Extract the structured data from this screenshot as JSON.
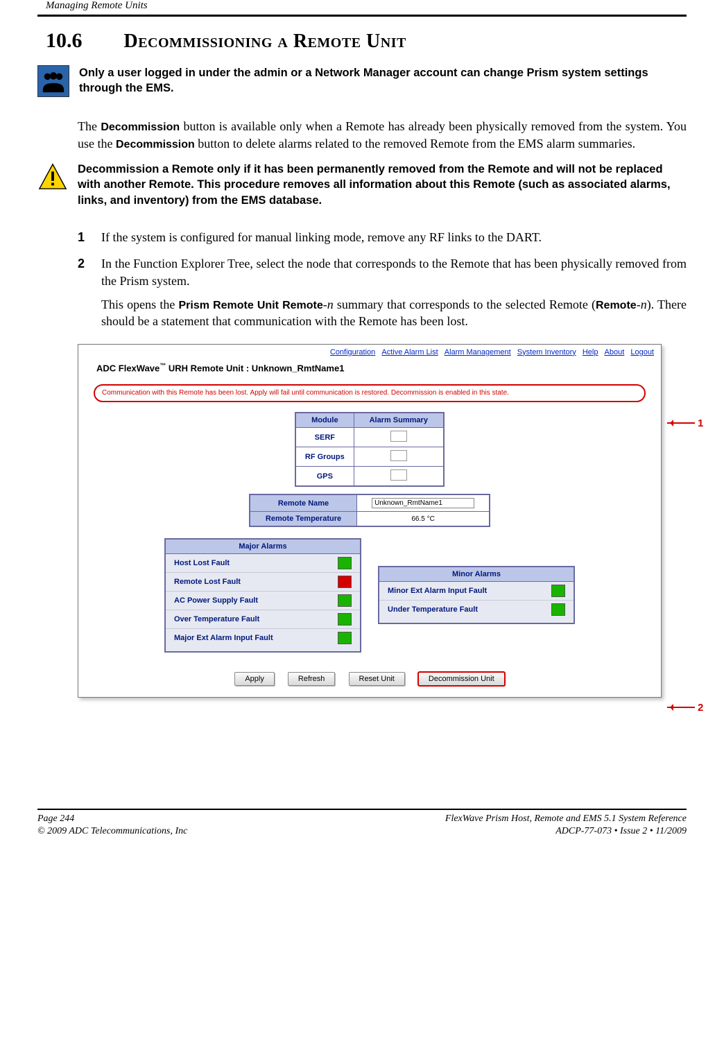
{
  "header": {
    "running_title": "Managing Remote Units"
  },
  "section": {
    "number": "10.6",
    "title": "Decommissioning a Remote Unit"
  },
  "admin_note": "Only a user logged in under the admin or a Network Manager account can change Prism system settings through the EMS.",
  "intro": {
    "pre": "The ",
    "b1": "Decommission",
    "mid": " button is available only when a Remote has already been physically removed from the system. You use the ",
    "b2": "Decommission",
    "post": " button to delete alarms related to the removed Remote from the EMS alarm summaries."
  },
  "warn_note": "Decommission a Remote only if it has been permanently removed from the Remote and will not be replaced with another Remote. This procedure removes all information about this Remote (such as associated alarms, links, and inventory) from the EMS database.",
  "steps": {
    "s1": "If the system is configured for manual linking mode, remove any RF links to the DART.",
    "s2": "In the Function Explorer Tree, select the node that corresponds to the Remote that has been physically removed from the Prism system.",
    "s2b": {
      "pre": "This opens the ",
      "b1": "Prism Remote Unit Remote",
      "dash1": "-",
      "i1": "n",
      "mid": " summary that corresponds to the selected Remote (",
      "b2": "Remote",
      "dash2": "-",
      "i2": "n",
      "post": "). There should be a statement that communication with the Remote has been lost."
    }
  },
  "screenshot": {
    "menu": [
      "Configuration",
      "Active Alarm List",
      "Alarm Management",
      "System Inventory",
      "Help",
      "About",
      "Logout"
    ],
    "title_prefix": "ADC FlexWave",
    "title_suffix": " URH Remote Unit : Unknown_RmtName1",
    "red_msg": "Communication with this Remote has been lost. Apply will fail until communication is restored. Decommission is enabled in this state.",
    "mod_table": {
      "headers": [
        "Module",
        "Alarm Summary"
      ],
      "rows": [
        "SERF",
        "RF Groups",
        "GPS"
      ]
    },
    "info_table": {
      "name_label": "Remote Name",
      "name_value": "Unknown_RmtName1",
      "temp_label": "Remote Temperature",
      "temp_value": "66.5 °C"
    },
    "major": {
      "title": "Major Alarms",
      "rows": [
        {
          "label": "Host Lost Fault",
          "color": "green"
        },
        {
          "label": "Remote Lost Fault",
          "color": "red"
        },
        {
          "label": "AC Power Supply Fault",
          "color": "green"
        },
        {
          "label": "Over Temperature Fault",
          "color": "green"
        },
        {
          "label": "Major Ext Alarm Input Fault",
          "color": "green"
        }
      ]
    },
    "minor": {
      "title": "Minor Alarms",
      "rows": [
        {
          "label": "Minor Ext Alarm Input Fault",
          "color": "green"
        },
        {
          "label": "Under Temperature Fault",
          "color": "green"
        }
      ]
    },
    "buttons": [
      "Apply",
      "Refresh",
      "Reset Unit",
      "Decommission Unit"
    ],
    "callouts": {
      "c1": "1",
      "c2": "2"
    }
  },
  "footer": {
    "page": "Page 244",
    "ref": "FlexWave Prism Host, Remote and EMS 5.1 System Reference",
    "copyright": "© 2009 ADC Telecommunications, Inc",
    "docnum": "ADCP-77-073  •  Issue 2  •  11/2009"
  }
}
